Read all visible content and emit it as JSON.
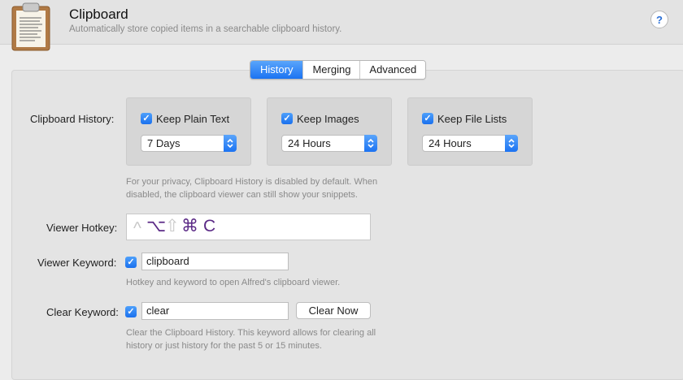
{
  "header": {
    "title": "Clipboard",
    "subtitle": "Automatically store copied items in a searchable clipboard history.",
    "help": "?"
  },
  "tabs": [
    {
      "label": "History",
      "active": true
    },
    {
      "label": "Merging",
      "active": false
    },
    {
      "label": "Advanced",
      "active": false
    }
  ],
  "history": {
    "label": "Clipboard History:",
    "options": [
      {
        "label": "Keep Plain Text",
        "checked": true,
        "duration": "7 Days"
      },
      {
        "label": "Keep Images",
        "checked": true,
        "duration": "24 Hours"
      },
      {
        "label": "Keep File Lists",
        "checked": true,
        "duration": "24 Hours"
      }
    ],
    "note_line1": "For your privacy, Clipboard History is disabled by default. When",
    "note_line2": "disabled, the clipboard viewer can still show your snippets."
  },
  "viewer": {
    "hotkey_label": "Viewer Hotkey:",
    "hotkey_keys": {
      "control": "^",
      "option": "⌥",
      "shift": "⇧",
      "command": "⌘",
      "key": "C"
    },
    "keyword_label": "Viewer Keyword:",
    "keyword_enabled": true,
    "keyword_value": "clipboard",
    "note": "Hotkey and keyword to open Alfred's clipboard viewer."
  },
  "clear": {
    "keyword_label": "Clear Keyword:",
    "keyword_enabled": true,
    "keyword_value": "clear",
    "button_label": "Clear Now",
    "note_line1": "Clear the Clipboard History. This keyword allows for clearing all",
    "note_line2": "history or just history for the past 5 or 15 minutes."
  },
  "colors": {
    "accent": "#1b73f2",
    "hotkey_active": "#5b2a86",
    "hotkey_inactive": "#c8c8c8"
  },
  "icons": [
    "clipboard-app-icon",
    "help-icon",
    "checkmark-icon",
    "stepper-arrows-icon"
  ]
}
